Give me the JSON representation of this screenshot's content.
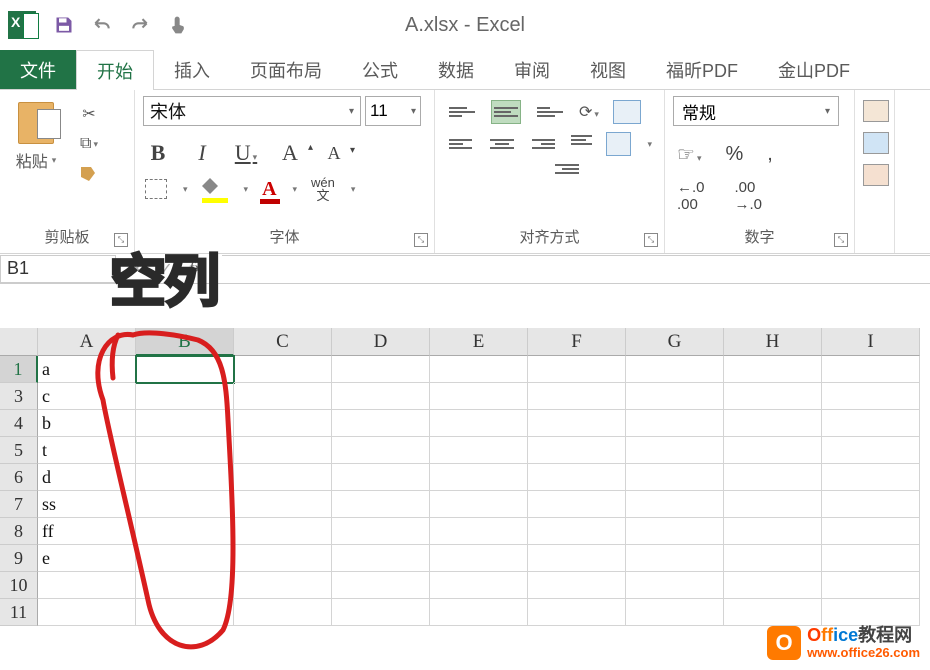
{
  "title": "A.xlsx - Excel",
  "tabs": {
    "file": "文件",
    "home": "开始",
    "insert": "插入",
    "page_layout": "页面布局",
    "formulas": "公式",
    "data": "数据",
    "review": "审阅",
    "view": "视图",
    "foxit": "福昕PDF",
    "wps": "金山PDF"
  },
  "ribbon": {
    "clipboard": {
      "label": "剪贴板",
      "paste": "粘贴"
    },
    "font": {
      "label": "字体",
      "name": "宋体",
      "size": "11",
      "wen_top": "wén",
      "wen_bottom": "文"
    },
    "alignment": {
      "label": "对齐方式"
    },
    "number": {
      "label": "数字",
      "format": "常规",
      "dec_inc": ".0",
      "dec_inc2": ".00",
      "dec_dec": ".00",
      "dec_dec2": "→.0"
    }
  },
  "name_box": "B1",
  "annotation_label": "空列",
  "columns": [
    "A",
    "B",
    "C",
    "D",
    "E",
    "F",
    "G",
    "H",
    "I"
  ],
  "rows": [
    {
      "num": "1",
      "a": "a"
    },
    {
      "num": "3",
      "a": "c"
    },
    {
      "num": "4",
      "a": "b"
    },
    {
      "num": "5",
      "a": "t"
    },
    {
      "num": "6",
      "a": "d"
    },
    {
      "num": "7",
      "a": "ss"
    },
    {
      "num": "8",
      "a": "ff"
    },
    {
      "num": "9",
      "a": "e"
    },
    {
      "num": "10",
      "a": ""
    },
    {
      "num": "11",
      "a": ""
    }
  ],
  "watermark": {
    "brand": "Office",
    "cn": "教程网",
    "url": "www.office26.com"
  }
}
